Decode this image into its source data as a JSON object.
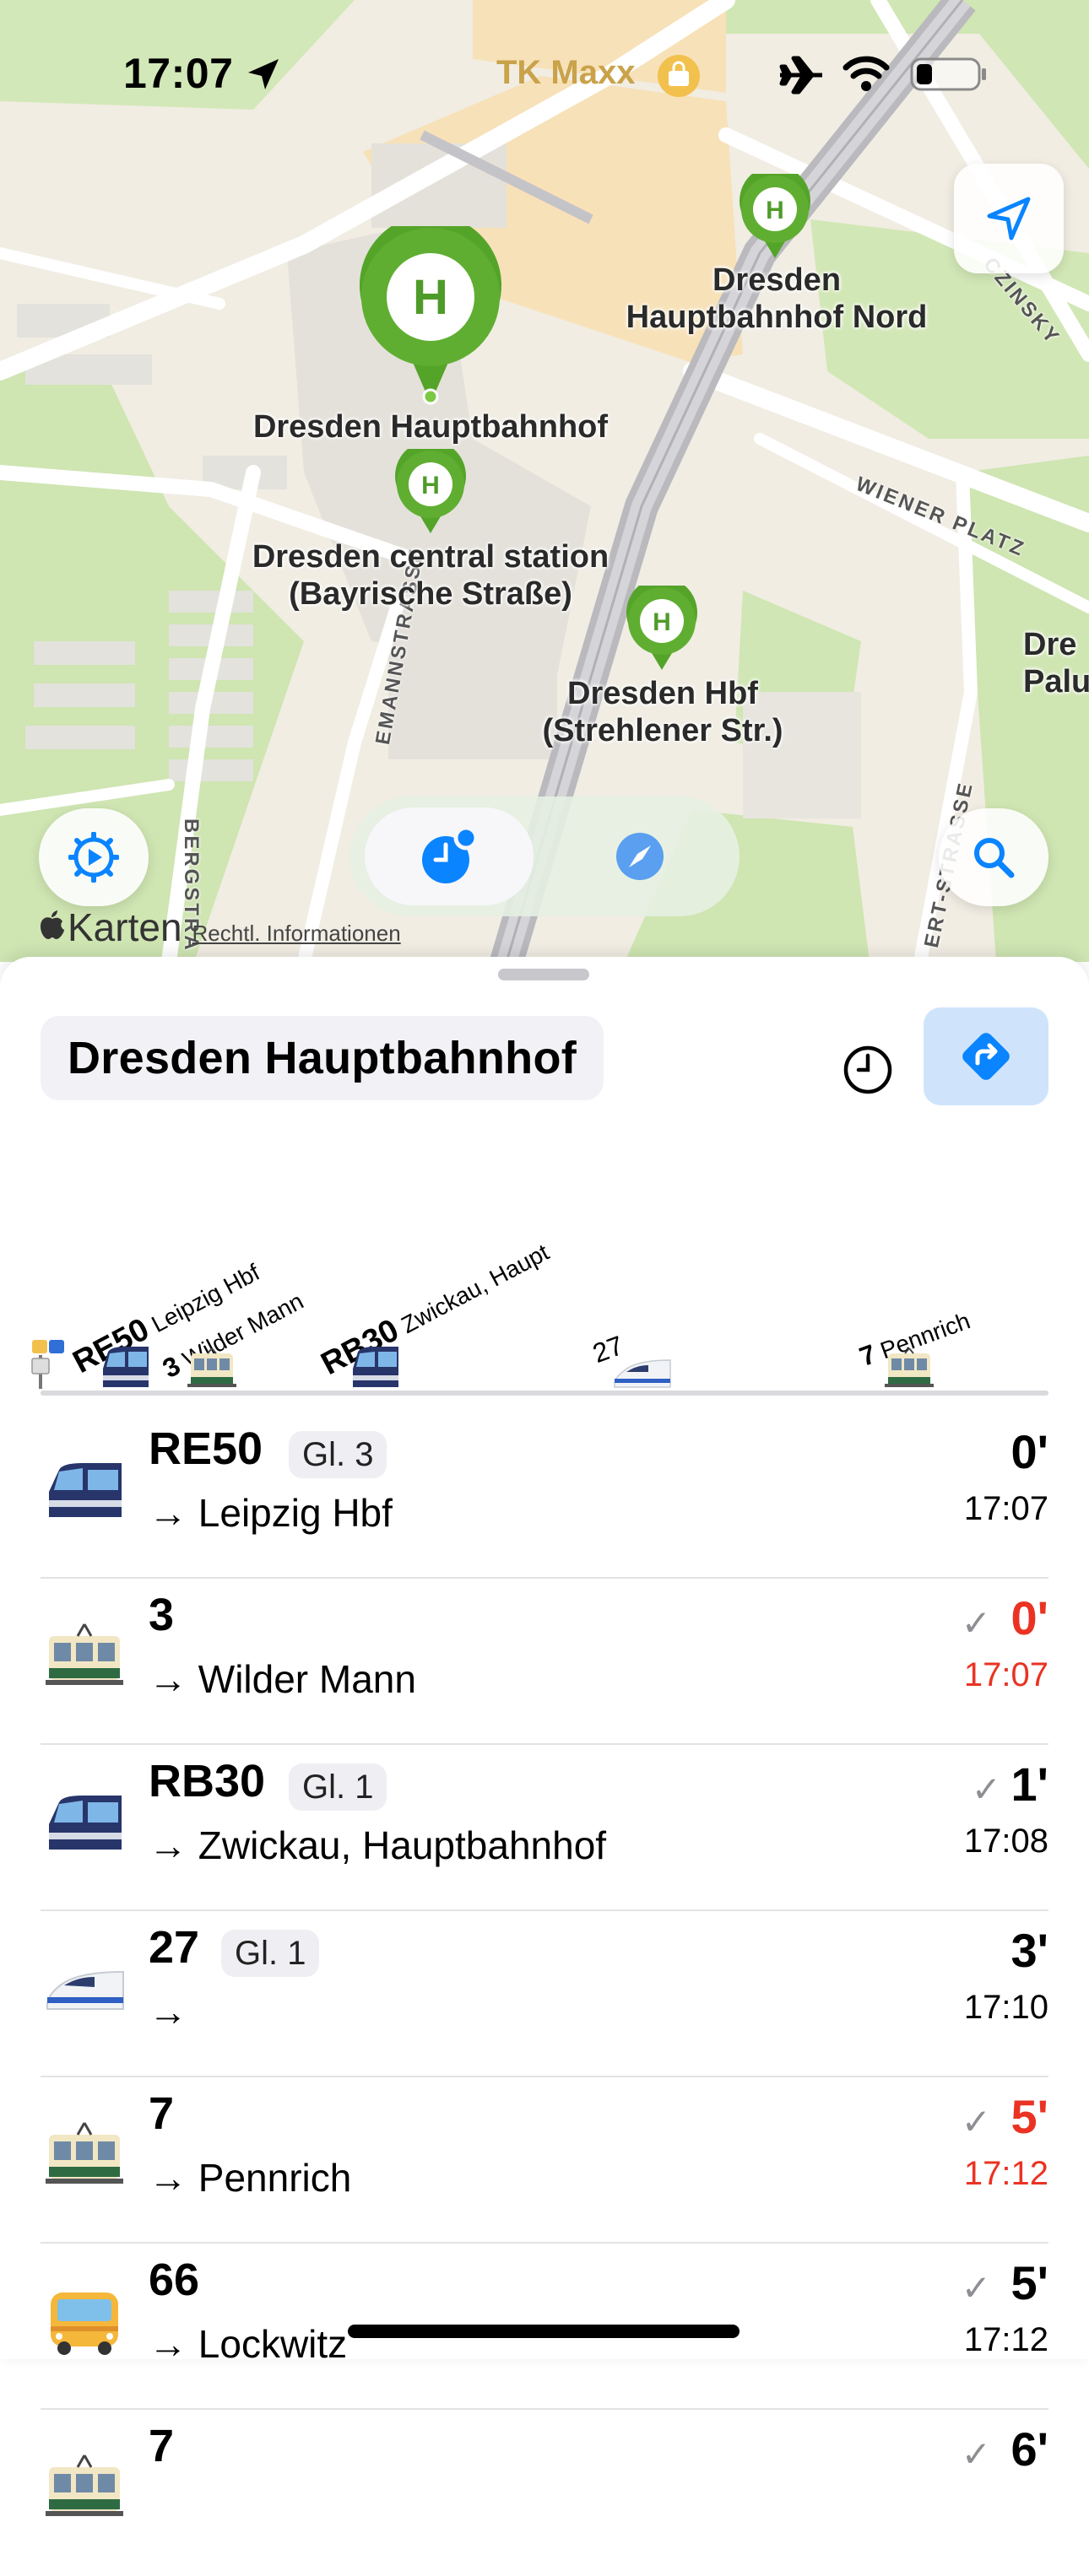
{
  "status_bar": {
    "time": "17:07",
    "poi_label": "TK Maxx"
  },
  "map": {
    "stations": [
      {
        "id": "hbf",
        "label": "Dresden Hauptbahnhof"
      },
      {
        "id": "hbf-nord",
        "label_line1": "Dresden",
        "label_line2": "Hauptbahnhof Nord"
      },
      {
        "id": "bayrische",
        "label_line1": "Dresden central station",
        "label_line2": "(Bayrische Straße)"
      },
      {
        "id": "strehlener",
        "label_line1": "Dresden Hbf",
        "label_line2": "(Strehlener Str.)"
      }
    ],
    "partial_labels": {
      "right_top": "Dre",
      "right_bottom": "Palu"
    },
    "streets": {
      "wiener_platz": "WIENER PLATZ",
      "czinsky": "CZINSKY",
      "bergstr": "BERGSTRA",
      "mannstr": "EMANNSTRASSE",
      "ertstr": "ERT-STRASSE"
    },
    "attribution": {
      "brand": "Karten",
      "legal": "Rechtl. Informationen"
    },
    "pin_letter": "H"
  },
  "sheet": {
    "title": "Dresden Hauptbahnhof",
    "timeline": [
      {
        "line": "RE50",
        "dest": "Leipzig Hbf"
      },
      {
        "line": "3",
        "dest": "Wilder Mann"
      },
      {
        "line": "RB30",
        "dest": "Zwickau, Haupt"
      },
      {
        "line": "27",
        "dest": ""
      },
      {
        "line": "7",
        "dest": "Pennrich"
      }
    ],
    "departures": [
      {
        "line": "RE50",
        "platform": "Gl. 3",
        "dest": "→ Leipzig Hbf",
        "mins": "0'",
        "time": "17:07",
        "checked": false,
        "delayed": false,
        "icon": "regional-train"
      },
      {
        "line": "3",
        "platform": "",
        "dest": "→ Wilder Mann",
        "mins": "0'",
        "time": "17:07",
        "checked": true,
        "delayed": true,
        "icon": "tram"
      },
      {
        "line": "RB30",
        "platform": "Gl. 1",
        "dest": "→ Zwickau, Hauptbahnhof",
        "mins": "1'",
        "time": "17:08",
        "checked": true,
        "delayed": false,
        "icon": "regional-train"
      },
      {
        "line": "27",
        "platform": "Gl. 1",
        "dest": "→",
        "mins": "3'",
        "time": "17:10",
        "checked": false,
        "delayed": false,
        "icon": "high-speed-train"
      },
      {
        "line": "7",
        "platform": "",
        "dest": "→ Pennrich",
        "mins": "5'",
        "time": "17:12",
        "checked": true,
        "delayed": true,
        "icon": "tram"
      },
      {
        "line": "66",
        "platform": "",
        "dest": "→ Lockwitz",
        "mins": "5'",
        "time": "17:12",
        "checked": true,
        "delayed": false,
        "icon": "bus"
      },
      {
        "line": "7",
        "platform": "",
        "dest": "",
        "mins": "6'",
        "time": "",
        "checked": true,
        "delayed": false,
        "icon": "tram"
      }
    ]
  },
  "colors": {
    "accent": "#0a84ff",
    "delay": "#ea3323",
    "pin_green": "#56a52d",
    "map_park": "#cde5b0",
    "map_land": "#f1ede3"
  }
}
